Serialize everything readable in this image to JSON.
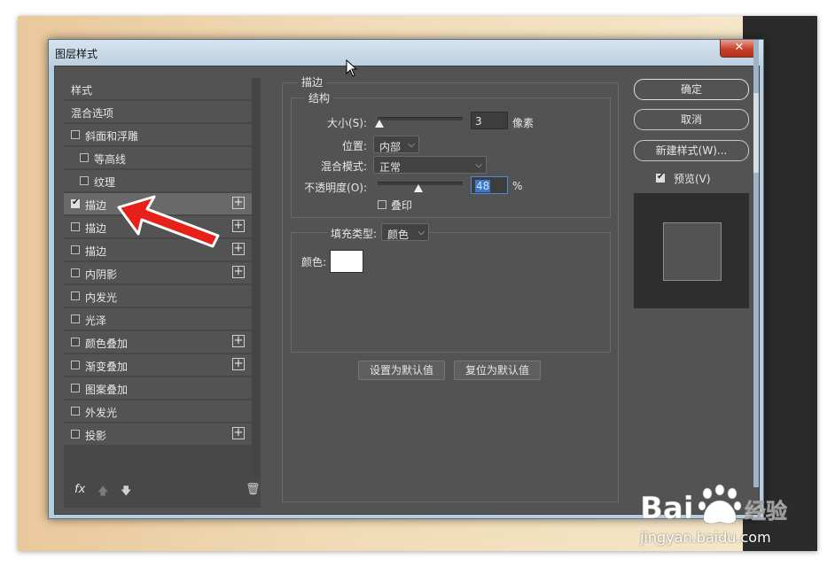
{
  "window": {
    "title": "图层样式",
    "close_glyph": "✕"
  },
  "styles_list": {
    "items": [
      {
        "label": "样式",
        "checkbox": false,
        "checked": false,
        "plus": false,
        "indent": 0,
        "selected": false
      },
      {
        "label": "混合选项",
        "checkbox": false,
        "checked": false,
        "plus": false,
        "indent": 0,
        "selected": false
      },
      {
        "label": "斜面和浮雕",
        "checkbox": true,
        "checked": false,
        "plus": false,
        "indent": 0,
        "selected": false
      },
      {
        "label": "等高线",
        "checkbox": true,
        "checked": false,
        "plus": false,
        "indent": 1,
        "selected": false
      },
      {
        "label": "纹理",
        "checkbox": true,
        "checked": false,
        "plus": false,
        "indent": 1,
        "selected": false
      },
      {
        "label": "描边",
        "checkbox": true,
        "checked": true,
        "plus": true,
        "indent": 0,
        "selected": true
      },
      {
        "label": "描边",
        "checkbox": true,
        "checked": false,
        "plus": true,
        "indent": 0,
        "selected": false
      },
      {
        "label": "描边",
        "checkbox": true,
        "checked": false,
        "plus": true,
        "indent": 0,
        "selected": false
      },
      {
        "label": "内阴影",
        "checkbox": true,
        "checked": false,
        "plus": true,
        "indent": 0,
        "selected": false
      },
      {
        "label": "内发光",
        "checkbox": true,
        "checked": false,
        "plus": false,
        "indent": 0,
        "selected": false
      },
      {
        "label": "光泽",
        "checkbox": true,
        "checked": false,
        "plus": false,
        "indent": 0,
        "selected": false
      },
      {
        "label": "颜色叠加",
        "checkbox": true,
        "checked": false,
        "plus": true,
        "indent": 0,
        "selected": false
      },
      {
        "label": "渐变叠加",
        "checkbox": true,
        "checked": false,
        "plus": true,
        "indent": 0,
        "selected": false
      },
      {
        "label": "图案叠加",
        "checkbox": true,
        "checked": false,
        "plus": false,
        "indent": 0,
        "selected": false
      },
      {
        "label": "外发光",
        "checkbox": true,
        "checked": false,
        "plus": false,
        "indent": 0,
        "selected": false
      },
      {
        "label": "投影",
        "checkbox": true,
        "checked": false,
        "plus": true,
        "indent": 0,
        "selected": false
      }
    ],
    "footer": {
      "fx_label": "fx",
      "up_glyph": "🡅",
      "down_glyph": "🡇",
      "trash_glyph": "🗑"
    }
  },
  "stroke_panel": {
    "title": "描边",
    "structure": {
      "title": "结构",
      "size_label": "大小(S):",
      "size_value": "3",
      "size_unit": "像素",
      "position_label": "位置:",
      "position_value": "内部",
      "blend_label": "混合模式:",
      "blend_value": "正常",
      "opacity_label": "不透明度(O):",
      "opacity_value": "48",
      "opacity_unit": "%",
      "opacity_fraction": 0.48,
      "overprint_label": "叠印",
      "overprint_checked": false
    },
    "fill": {
      "fill_type_label": "填充类型:",
      "fill_type_value": "颜色",
      "color_label": "颜色:",
      "color_value": "#ffffff"
    },
    "buttons": {
      "set_default": "设置为默认值",
      "reset_default": "复位为默认值"
    }
  },
  "right_panel": {
    "ok": "确定",
    "cancel": "取消",
    "new_style": "新建样式(W)...",
    "preview_label": "预览(V)",
    "preview_checked": true
  },
  "watermark": {
    "brand": "Bai",
    "brand2": "du",
    "jingyan": "经验",
    "url": "jingyan.baidu.com"
  },
  "colors": {
    "panel_bg": "#535353",
    "annotation_arrow": "#e8201a",
    "highlight": "#3b78d0"
  }
}
